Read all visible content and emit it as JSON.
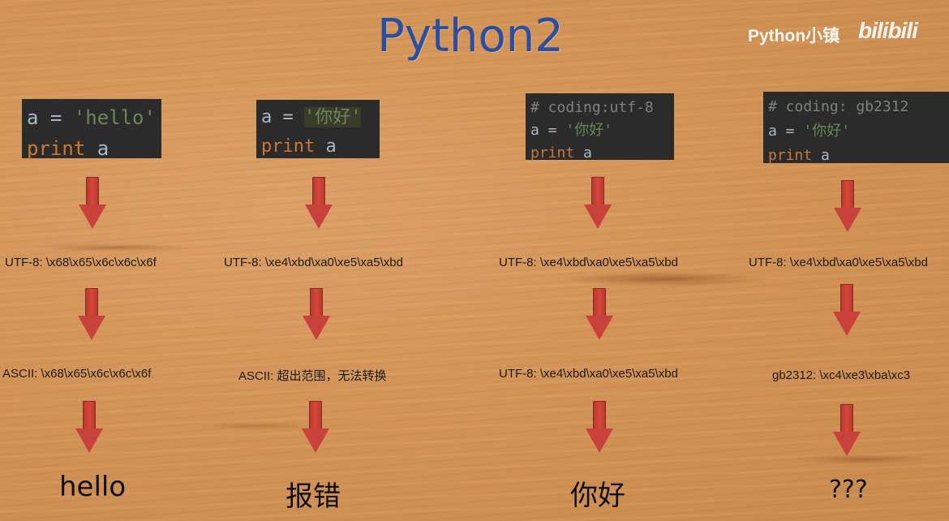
{
  "title": "Python2",
  "watermark": {
    "channel": "Python小镇",
    "logo": "bilibili"
  },
  "columns": [
    {
      "code": {
        "l1_a": "a = ",
        "l1_str": "'hello'",
        "l2_kw": "print",
        "l2_var": " a"
      },
      "step1": "UTF-8:   \\x68\\x65\\x6c\\x6c\\x6f",
      "step2": "ASCII:   \\x68\\x65\\x6c\\x6c\\x6f",
      "result": "hello"
    },
    {
      "code": {
        "l1_a": "a = ",
        "l1_str": "'你好'",
        "l2_kw": "print",
        "l2_var": " a"
      },
      "step1": "UTF-8:  \\xe4\\xbd\\xa0\\xe5\\xa5\\xbd",
      "step2": "ASCII:  超出范围，无法转换",
      "result": "报错"
    },
    {
      "code": {
        "l0_comment": "# coding:utf-8",
        "l1_a": "a = ",
        "l1_str": "'你好'",
        "l2_kw": "print",
        "l2_var": " a"
      },
      "step1": "UTF-8:  \\xe4\\xbd\\xa0\\xe5\\xa5\\xbd",
      "step2": "UTF-8:  \\xe4\\xbd\\xa0\\xe5\\xa5\\xbd",
      "result": "你好"
    },
    {
      "code": {
        "l0_comment": "# coding: gb2312",
        "l1_a": "a = ",
        "l1_str": "'你好'",
        "l2_kw": "print",
        "l2_var": " a"
      },
      "step1": "UTF-8:  \\xe4\\xbd\\xa0\\xe5\\xa5\\xbd",
      "step2": "gb2312:  \\xc4\\xe3\\xba\\xc3",
      "result": "???"
    }
  ]
}
